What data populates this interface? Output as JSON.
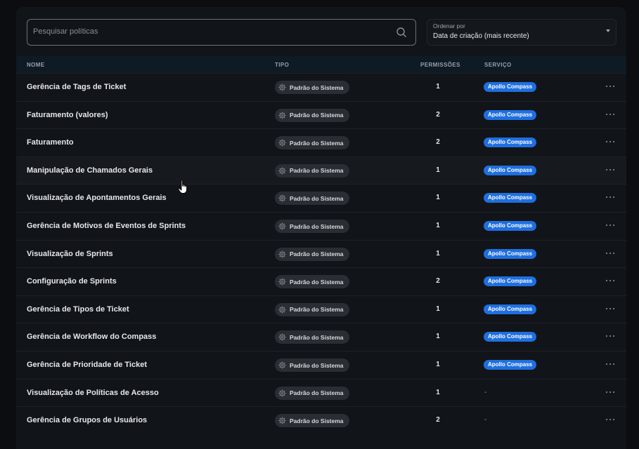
{
  "search": {
    "placeholder": "Pesquisar políticas"
  },
  "sort": {
    "label": "Ordenar por",
    "value": "Data de criação (mais recente)"
  },
  "table": {
    "headers": {
      "name": "NOME",
      "type": "TIPO",
      "permissions": "PERMISSÕES",
      "service": "SERVIÇO"
    },
    "rows": [
      {
        "name": "Gerência de Tags de Ticket",
        "type": "Padrão do Sistema",
        "permissions": "1",
        "service": "Apollo Compass"
      },
      {
        "name": "Faturamento (valores)",
        "type": "Padrão do Sistema",
        "permissions": "2",
        "service": "Apollo Compass"
      },
      {
        "name": "Faturamento",
        "type": "Padrão do Sistema",
        "permissions": "2",
        "service": "Apollo Compass"
      },
      {
        "name": "Manipulação de Chamados Gerais",
        "type": "Padrão do Sistema",
        "permissions": "1",
        "service": "Apollo Compass"
      },
      {
        "name": "Visualização de Apontamentos Gerais",
        "type": "Padrão do Sistema",
        "permissions": "1",
        "service": "Apollo Compass"
      },
      {
        "name": "Gerência de Motivos de Eventos de Sprints",
        "type": "Padrão do Sistema",
        "permissions": "1",
        "service": "Apollo Compass"
      },
      {
        "name": "Visualização de Sprints",
        "type": "Padrão do Sistema",
        "permissions": "1",
        "service": "Apollo Compass"
      },
      {
        "name": "Configuração de Sprints",
        "type": "Padrão do Sistema",
        "permissions": "2",
        "service": "Apollo Compass"
      },
      {
        "name": "Gerência de Tipos de Ticket",
        "type": "Padrão do Sistema",
        "permissions": "1",
        "service": "Apollo Compass"
      },
      {
        "name": "Gerência de Workflow do Compass",
        "type": "Padrão do Sistema",
        "permissions": "1",
        "service": "Apollo Compass"
      },
      {
        "name": "Gerência de Prioridade de Ticket",
        "type": "Padrão do Sistema",
        "permissions": "1",
        "service": "Apollo Compass"
      },
      {
        "name": "Visualização de Políticas de Acesso",
        "type": "Padrão do Sistema",
        "permissions": "1",
        "service": "-"
      },
      {
        "name": "Gerência de Grupos de Usuários",
        "type": "Padrão do Sistema",
        "permissions": "2",
        "service": "-"
      }
    ],
    "hovered_row": 3
  },
  "colors": {
    "background": "#0b0d10",
    "panel": "#111419",
    "service_badge": "#1f6fe0",
    "type_pill": "#2a2d33"
  },
  "icons": {
    "search": "search-icon",
    "sort": "chevron-down-icon",
    "type": "gear-icon",
    "row_actions": "more-horizontal-icon",
    "cursor": "hand-pointer-cursor"
  }
}
